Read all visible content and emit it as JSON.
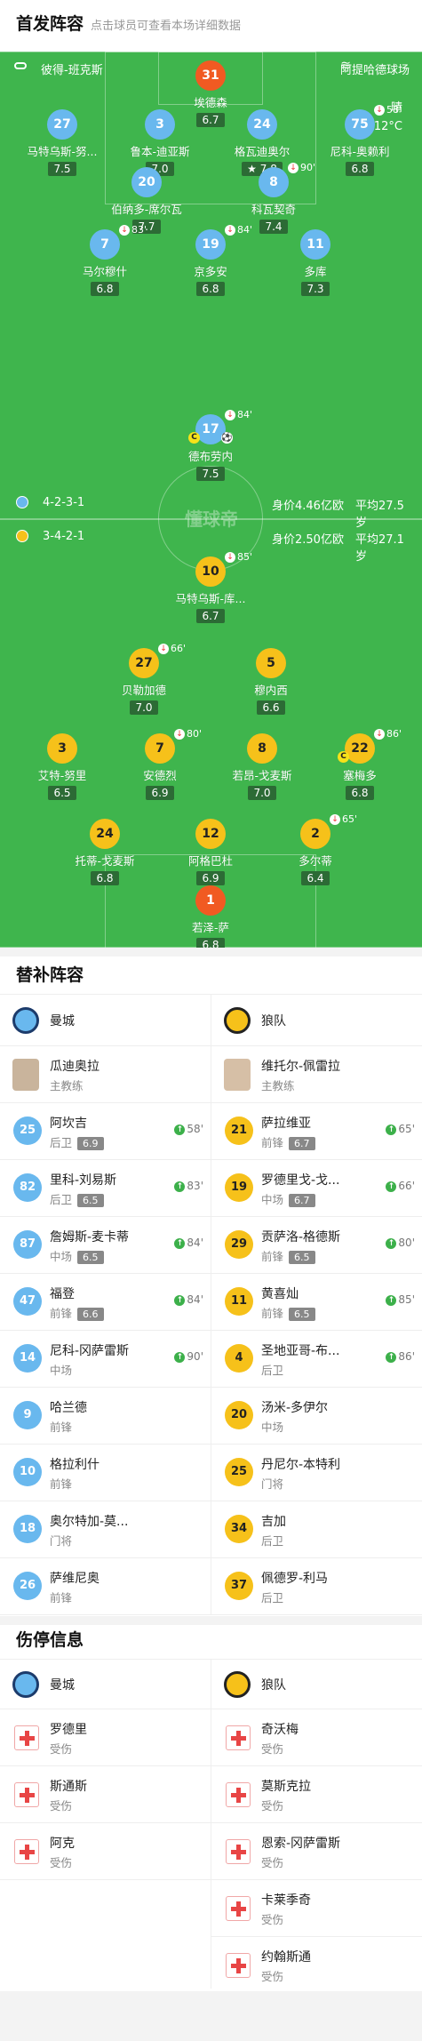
{
  "header": {
    "title": "首发阵容",
    "subtitle": "点击球员可查看本场详细数据"
  },
  "pitch": {
    "home_stadium": "彼得-班克斯",
    "away_stadium": "阿提哈德球场",
    "weather": "晴",
    "temperature": "12°C",
    "home": {
      "formation": "4-2-3-1",
      "value": "身价4.46亿欧",
      "age": "平均27.5岁"
    },
    "away": {
      "formation": "3-4-2-1",
      "value": "身价2.50亿欧",
      "age": "平均27.1岁"
    },
    "watermark": "懂球帝",
    "players": [
      {
        "num": "31",
        "name": "埃德森",
        "rating": "6.7",
        "team": "gk-home"
      },
      {
        "num": "27",
        "name": "马特乌斯-努...",
        "rating": "7.5",
        "team": "home"
      },
      {
        "num": "3",
        "name": "鲁本-迪亚斯",
        "rating": "7.0",
        "team": "home"
      },
      {
        "num": "24",
        "name": "格瓦迪奥尔",
        "rating": "7.8",
        "team": "home",
        "star": "★"
      },
      {
        "num": "75",
        "name": "尼科-奥赖利",
        "rating": "6.8",
        "team": "home",
        "sub": "58'"
      },
      {
        "num": "20",
        "name": "伯纳多-席尔瓦",
        "rating": "7.7",
        "team": "home"
      },
      {
        "num": "8",
        "name": "科瓦契奇",
        "rating": "7.4",
        "team": "home",
        "sub": "90'"
      },
      {
        "num": "7",
        "name": "马尔穆什",
        "rating": "6.8",
        "team": "home",
        "sub": "83'"
      },
      {
        "num": "19",
        "name": "京多安",
        "rating": "6.8",
        "team": "home",
        "sub": "84'"
      },
      {
        "num": "11",
        "name": "多库",
        "rating": "7.3",
        "team": "home"
      },
      {
        "num": "17",
        "name": "德布劳内",
        "rating": "7.5",
        "team": "home",
        "sub": "84'",
        "captain": "C",
        "ball": "⚽"
      },
      {
        "num": "10",
        "name": "马特乌斯-库...",
        "rating": "6.7",
        "team": "away",
        "sub": "85'"
      },
      {
        "num": "27",
        "name": "贝勒加德",
        "rating": "7.0",
        "team": "away",
        "sub": "66'"
      },
      {
        "num": "5",
        "name": "穆内西",
        "rating": "6.6",
        "team": "away"
      },
      {
        "num": "3",
        "name": "艾特-努里",
        "rating": "6.5",
        "team": "away"
      },
      {
        "num": "7",
        "name": "安德烈",
        "rating": "6.9",
        "team": "away",
        "sub": "80'"
      },
      {
        "num": "8",
        "name": "若昂-戈麦斯",
        "rating": "7.0",
        "team": "away"
      },
      {
        "num": "22",
        "name": "塞梅多",
        "rating": "6.8",
        "team": "away",
        "sub": "86'",
        "captain": "C"
      },
      {
        "num": "24",
        "name": "托蒂-戈麦斯",
        "rating": "6.8",
        "team": "away"
      },
      {
        "num": "12",
        "name": "阿格巴杜",
        "rating": "6.9",
        "team": "away"
      },
      {
        "num": "2",
        "name": "多尔蒂",
        "rating": "6.4",
        "team": "away",
        "sub": "65'"
      },
      {
        "num": "1",
        "name": "若泽-萨",
        "rating": "6.8",
        "team": "gk-away"
      }
    ]
  },
  "subs": {
    "title": "替补阵容",
    "home_team": "曼城",
    "away_team": "狼队",
    "home_coach": {
      "name": "瓜迪奥拉",
      "role": "主教练"
    },
    "away_coach": {
      "name": "维托尔-佩雷拉",
      "role": "主教练"
    },
    "home": [
      {
        "num": "25",
        "name": "阿坎吉",
        "pos": "后卫",
        "rating": "6.9",
        "time": "58'"
      },
      {
        "num": "82",
        "name": "里科-刘易斯",
        "pos": "后卫",
        "rating": "6.5",
        "time": "83'"
      },
      {
        "num": "87",
        "name": "詹姆斯-麦卡蒂",
        "pos": "中场",
        "rating": "6.5",
        "time": "84'"
      },
      {
        "num": "47",
        "name": "福登",
        "pos": "前锋",
        "rating": "6.6",
        "time": "84'"
      },
      {
        "num": "14",
        "name": "尼科-冈萨雷斯",
        "pos": "中场",
        "rating": "",
        "time": "90'"
      },
      {
        "num": "9",
        "name": "哈兰德",
        "pos": "前锋",
        "rating": "",
        "time": ""
      },
      {
        "num": "10",
        "name": "格拉利什",
        "pos": "前锋",
        "rating": "",
        "time": ""
      },
      {
        "num": "18",
        "name": "奥尔特加-莫...",
        "pos": "门将",
        "rating": "",
        "time": ""
      },
      {
        "num": "26",
        "name": "萨维尼奥",
        "pos": "前锋",
        "rating": "",
        "time": ""
      }
    ],
    "away": [
      {
        "num": "21",
        "name": "萨拉维亚",
        "pos": "前锋",
        "rating": "6.7",
        "time": "65'"
      },
      {
        "num": "19",
        "name": "罗德里戈-戈...",
        "pos": "中场",
        "rating": "6.7",
        "time": "66'"
      },
      {
        "num": "29",
        "name": "贡萨洛-格德斯",
        "pos": "前锋",
        "rating": "6.5",
        "time": "80'"
      },
      {
        "num": "11",
        "name": "黄喜灿",
        "pos": "前锋",
        "rating": "6.5",
        "time": "85'"
      },
      {
        "num": "4",
        "name": "圣地亚哥-布...",
        "pos": "后卫",
        "rating": "",
        "time": "86'"
      },
      {
        "num": "20",
        "name": "汤米-多伊尔",
        "pos": "中场",
        "rating": "",
        "time": ""
      },
      {
        "num": "25",
        "name": "丹尼尔-本特利",
        "pos": "门将",
        "rating": "",
        "time": ""
      },
      {
        "num": "34",
        "name": "吉加",
        "pos": "后卫",
        "rating": "",
        "time": ""
      },
      {
        "num": "37",
        "name": "佩德罗-利马",
        "pos": "后卫",
        "rating": "",
        "time": ""
      }
    ]
  },
  "injuries": {
    "title": "伤停信息",
    "home_team": "曼城",
    "away_team": "狼队",
    "home": [
      {
        "name": "罗德里",
        "status": "受伤"
      },
      {
        "name": "斯通斯",
        "status": "受伤"
      },
      {
        "name": "阿克",
        "status": "受伤"
      }
    ],
    "away": [
      {
        "name": "奇沃梅",
        "status": "受伤"
      },
      {
        "name": "莫斯克拉",
        "status": "受伤"
      },
      {
        "name": "恩索-冈萨雷斯",
        "status": "受伤"
      },
      {
        "name": "卡莱季奇",
        "status": "受伤"
      },
      {
        "name": "约翰斯通",
        "status": "受伤"
      }
    ]
  },
  "colors": {
    "pitch": "#3fb54d",
    "home": "#69b8ee",
    "away": "#f6c11a",
    "gk_home": "#f15a22",
    "sub_arrow": "#3cb04a"
  }
}
